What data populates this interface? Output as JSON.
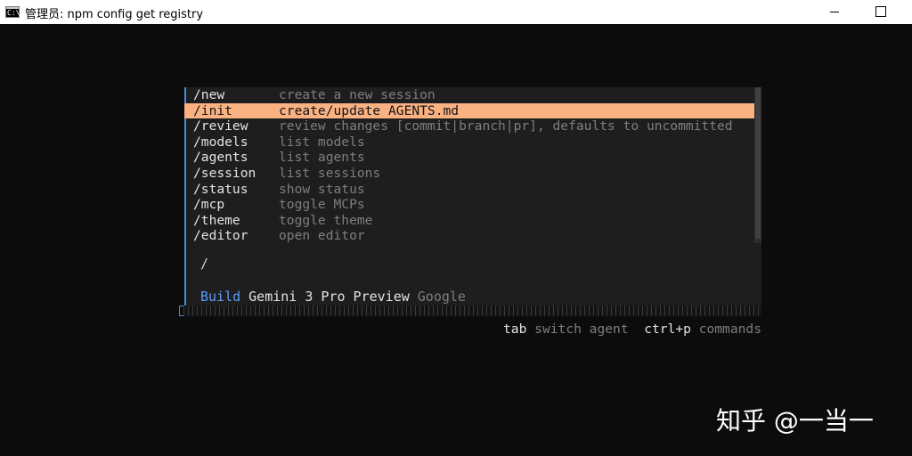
{
  "window": {
    "title": "管理员: npm config get registry",
    "icon": "C:\\",
    "minimize_icon": "minimize-icon",
    "maximize_icon": "maximize-icon"
  },
  "command_menu": {
    "selected_index": 1,
    "items": [
      {
        "command": "/new",
        "description": "create a new session"
      },
      {
        "command": "/init",
        "description": "create/update AGENTS.md"
      },
      {
        "command": "/review",
        "description": "review changes [commit|branch|pr], defaults to uncommitted"
      },
      {
        "command": "/models",
        "description": "list models"
      },
      {
        "command": "/agents",
        "description": "list agents"
      },
      {
        "command": "/session",
        "description": "list sessions"
      },
      {
        "command": "/status",
        "description": "show status"
      },
      {
        "command": "/mcp",
        "description": "toggle MCPs"
      },
      {
        "command": "/theme",
        "description": "toggle theme"
      },
      {
        "command": "/editor",
        "description": "open editor"
      }
    ]
  },
  "input": {
    "value": "/"
  },
  "status": {
    "agent": "Build",
    "model": "Gemini 3 Pro Preview",
    "provider": "Google"
  },
  "hints": {
    "tab_key": "tab",
    "tab_label": "switch agent",
    "commands_key": "ctrl+p",
    "commands_label": "commands"
  },
  "watermark": "知乎 @一当一",
  "colors": {
    "background": "#0c0c0c",
    "panel": "#1e1e1e",
    "selection": "#fab283",
    "accent": "#4a8ae0",
    "agent": "#5c9cf5",
    "muted_text": "#7e7e7e",
    "primary_text": "#e3e3e3"
  }
}
